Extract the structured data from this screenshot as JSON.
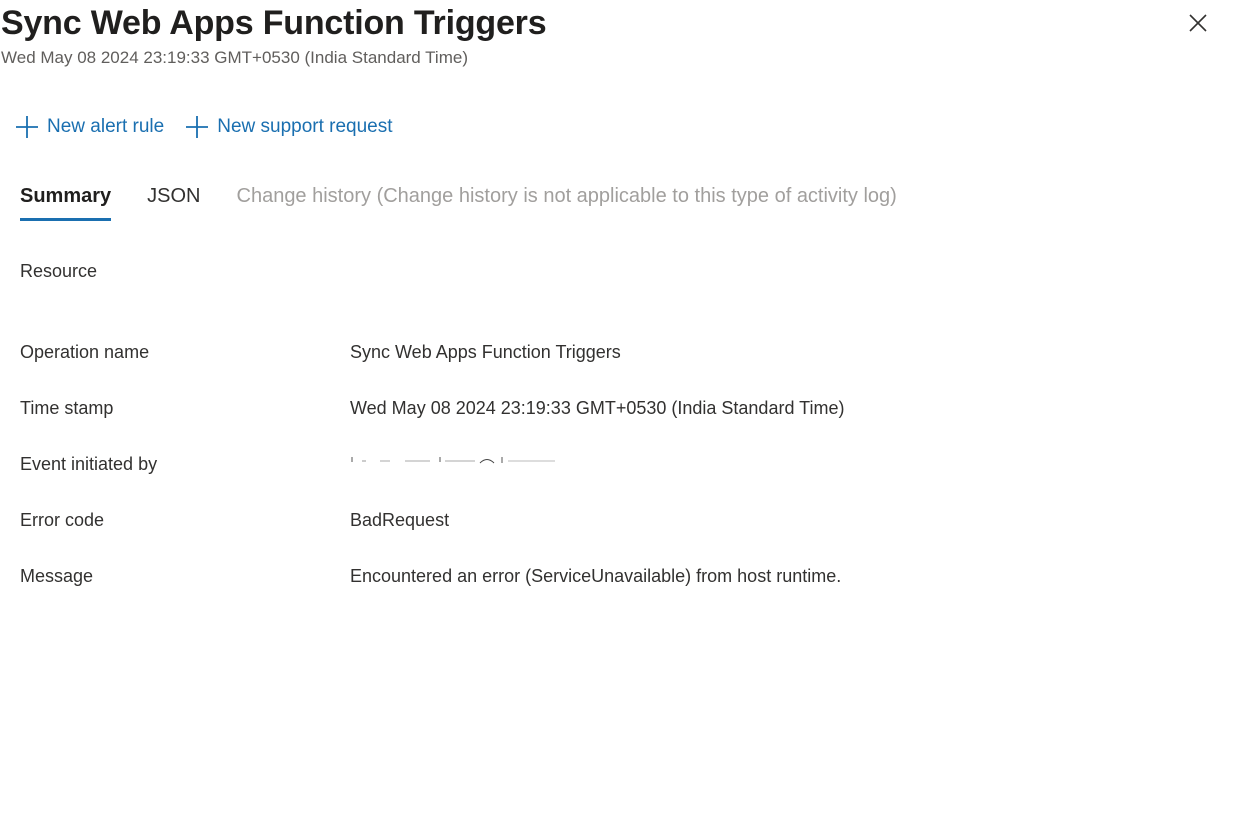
{
  "header": {
    "title": "Sync Web Apps Function Triggers",
    "subtitle": "Wed May 08 2024 23:19:33 GMT+0530 (India Standard Time)",
    "close_icon": "close-icon"
  },
  "toolbar": {
    "new_alert_rule": {
      "icon": "plus-icon",
      "label": "New alert rule"
    },
    "new_support_request": {
      "icon": "plus-icon",
      "label": "New support request"
    }
  },
  "tabs": [
    {
      "label": "Summary",
      "active": true
    },
    {
      "label": "JSON",
      "active": false
    },
    {
      "label": "Change history (Change history is not applicable to this type of activity log)",
      "disabled": true
    }
  ],
  "summary": {
    "resource": {
      "label": "Resource",
      "value": ""
    },
    "operation_name": {
      "label": "Operation name",
      "value": "Sync Web Apps Function Triggers"
    },
    "time_stamp": {
      "label": "Time stamp",
      "value": "Wed May 08 2024 23:19:33 GMT+0530 (India Standard Time)"
    },
    "event_initiated_by": {
      "label": "Event initiated by",
      "value": "[redacted]"
    },
    "error_code": {
      "label": "Error code",
      "value": "BadRequest"
    },
    "message": {
      "label": "Message",
      "value": "Encountered an error (ServiceUnavailable) from host runtime."
    }
  },
  "colors": {
    "accent": "#1a6fb0",
    "text": "#323130",
    "muted": "#605e5c",
    "disabled": "#a19f9d"
  }
}
